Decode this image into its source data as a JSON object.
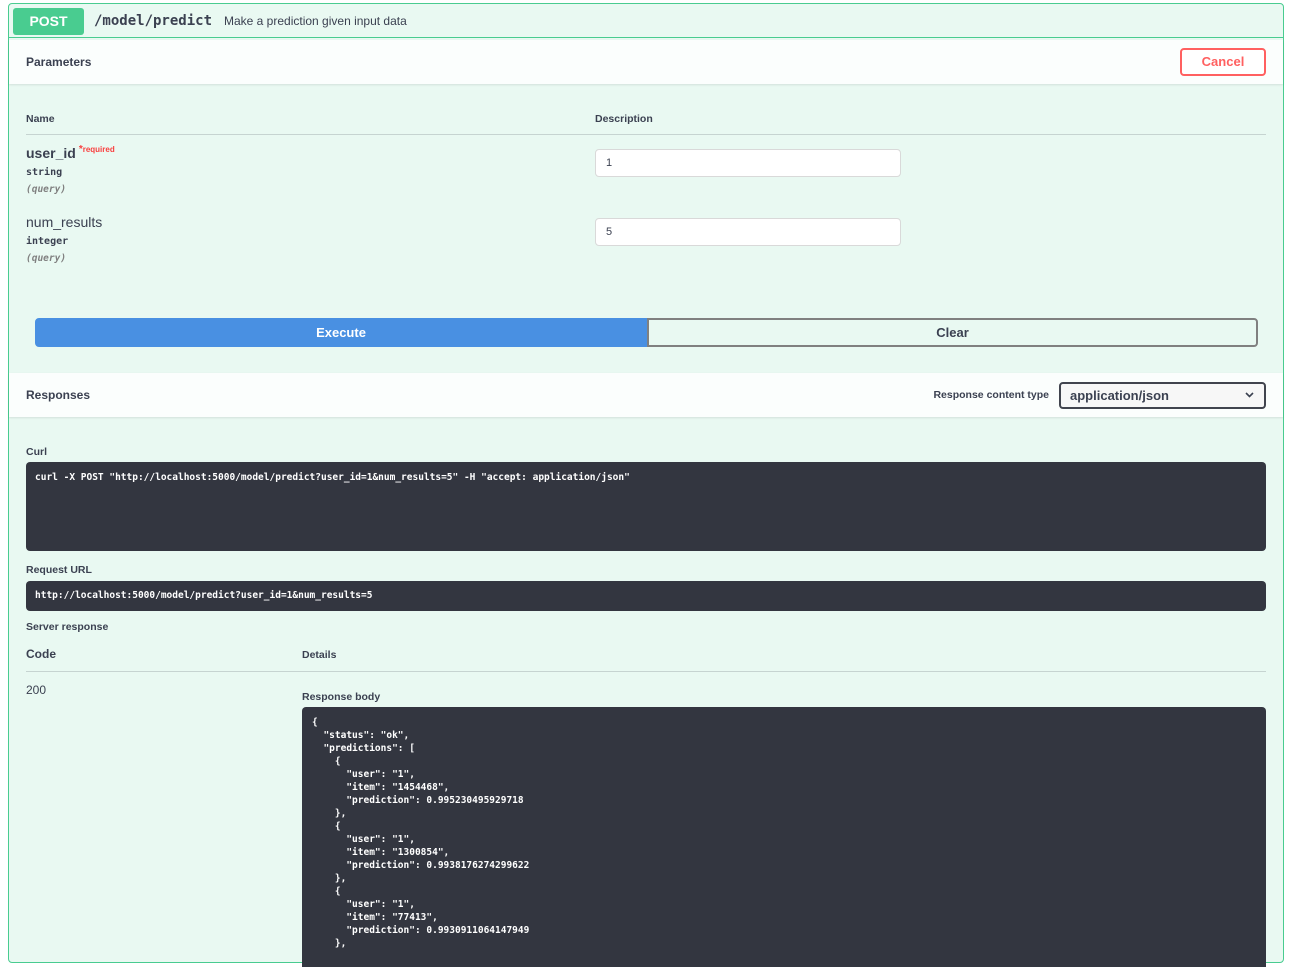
{
  "operation": {
    "method": "POST",
    "path": "/model/predict",
    "summary": "Make a prediction given input data"
  },
  "parameters": {
    "title": "Parameters",
    "cancel_label": "Cancel",
    "col_name": "Name",
    "col_description": "Description",
    "items": [
      {
        "name": "user_id",
        "required_star": "*",
        "required_text": "required",
        "type": "string",
        "in": "(query)",
        "value": "1"
      },
      {
        "name": "num_results",
        "type": "integer",
        "in": "(query)",
        "value": "5"
      }
    ]
  },
  "actions": {
    "execute_label": "Execute",
    "clear_label": "Clear"
  },
  "responses": {
    "title": "Responses",
    "content_type_label": "Response content type",
    "content_type_value": "application/json",
    "curl_label": "Curl",
    "curl": "curl -X POST \"http://localhost:5000/model/predict?user_id=1&num_results=5\" -H \"accept: application/json\"",
    "request_url_label": "Request URL",
    "request_url": "http://localhost:5000/model/predict?user_id=1&num_results=5",
    "server_response_label": "Server response",
    "code_header": "Code",
    "details_header": "Details",
    "code": "200",
    "response_body_label": "Response body",
    "response_body": "{\n  \"status\": \"ok\",\n  \"predictions\": [\n    {\n      \"user\": \"1\",\n      \"item\": \"1454468\",\n      \"prediction\": 0.995230495929718\n    },\n    {\n      \"user\": \"1\",\n      \"item\": \"1300854\",\n      \"prediction\": 0.9938176274299622\n    },\n    {\n      \"user\": \"1\",\n      \"item\": \"77413\",\n      \"prediction\": 0.9930911064147949\n    },"
  },
  "colors": {
    "post": "#49cc90",
    "execute": "#4990e2",
    "cancel": "#ff6060",
    "code_bg": "#333640"
  }
}
